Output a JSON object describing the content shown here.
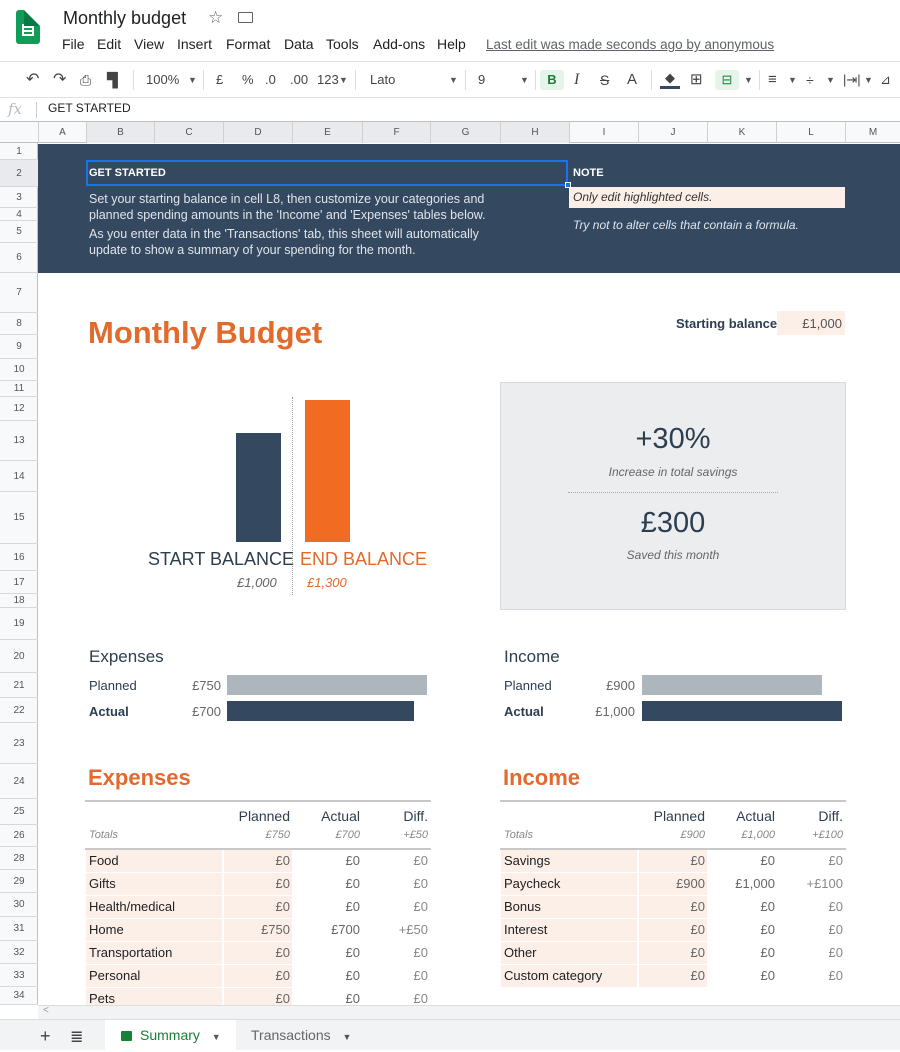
{
  "app": {
    "title": "Monthly budget",
    "menus": [
      "File",
      "Edit",
      "View",
      "Insert",
      "Format",
      "Data",
      "Tools",
      "Add-ons",
      "Help"
    ],
    "last_edit": "Last edit was made seconds ago by anonymous",
    "star_icon": "☆"
  },
  "toolbar": {
    "zoom": "100%",
    "currency": "£",
    "percent": "%",
    "dec_decrease": ".0",
    "dec_increase": ".00",
    "more_formats": "123",
    "font": "Lato",
    "font_size": "9",
    "bold": "B",
    "italic": "I",
    "strike": "S",
    "text_color": "A"
  },
  "formula_bar": {
    "fx": "fx",
    "value": "GET STARTED"
  },
  "columns": [
    "A",
    "B",
    "C",
    "D",
    "E",
    "F",
    "G",
    "H",
    "I",
    "J",
    "K",
    "L",
    "M"
  ],
  "rows": [
    "1",
    "2",
    "3",
    "4",
    "5",
    "6",
    "7",
    "8",
    "9",
    "10",
    "11",
    "12",
    "13",
    "14",
    "15",
    "16",
    "17",
    "18",
    "19",
    "20",
    "21",
    "22",
    "23",
    "24",
    "25",
    "26",
    "28",
    "29",
    "30",
    "31",
    "32",
    "33",
    "34"
  ],
  "banner": {
    "get_started": "GET STARTED",
    "line1": "Set your starting balance in cell L8, then customize your categories and",
    "line2": "planned spending amounts in the 'Income' and 'Expenses' tables below.",
    "line3": "As you enter data in the 'Transactions' tab, this sheet will automatically",
    "line4": "update to show a summary of your spending for the month.",
    "note": "NOTE",
    "note_highlight": "Only edit highlighted cells.",
    "note_2": "Try not to alter cells that contain a formula."
  },
  "main": {
    "title": "Monthly Budget",
    "starting_balance_label": "Starting balance:",
    "starting_balance_value": "£1,000"
  },
  "balance_chart": {
    "start_label": "START BALANCE",
    "end_label": "END BALANCE",
    "start_value_text": "£1,000",
    "end_value_text": "£1,300",
    "start_value": 1000,
    "end_value": 1300
  },
  "kpi": {
    "pct": "+30%",
    "pct_label": "Increase in total savings",
    "amount": "£300",
    "amount_label": "Saved this month"
  },
  "summary": {
    "expenses": {
      "title": "Expenses",
      "planned_label": "Planned",
      "actual_label": "Actual",
      "planned_text": "£750",
      "actual_text": "£700",
      "planned": 750,
      "actual": 700
    },
    "income": {
      "title": "Income",
      "planned_label": "Planned",
      "actual_label": "Actual",
      "planned_text": "£900",
      "actual_text": "£1,000",
      "planned": 900,
      "actual": 1000
    }
  },
  "expenses_table": {
    "title": "Expenses",
    "headers": [
      "Planned",
      "Actual",
      "Diff."
    ],
    "totals_label": "Totals",
    "totals": [
      "£750",
      "£700",
      "+£50"
    ],
    "rows": [
      {
        "cat": "Food",
        "planned": "£0",
        "actual": "£0",
        "diff": "£0"
      },
      {
        "cat": "Gifts",
        "planned": "£0",
        "actual": "£0",
        "diff": "£0"
      },
      {
        "cat": "Health/medical",
        "planned": "£0",
        "actual": "£0",
        "diff": "£0"
      },
      {
        "cat": "Home",
        "planned": "£750",
        "actual": "£700",
        "diff": "+£50"
      },
      {
        "cat": "Transportation",
        "planned": "£0",
        "actual": "£0",
        "diff": "£0"
      },
      {
        "cat": "Personal",
        "planned": "£0",
        "actual": "£0",
        "diff": "£0"
      },
      {
        "cat": "Pets",
        "planned": "£0",
        "actual": "£0",
        "diff": "£0"
      }
    ]
  },
  "income_table": {
    "title": "Income",
    "headers": [
      "Planned",
      "Actual",
      "Diff."
    ],
    "totals_label": "Totals",
    "totals": [
      "£900",
      "£1,000",
      "+£100"
    ],
    "rows": [
      {
        "cat": "Savings",
        "planned": "£0",
        "actual": "£0",
        "diff": "£0"
      },
      {
        "cat": "Paycheck",
        "planned": "£900",
        "actual": "£1,000",
        "diff": "+£100"
      },
      {
        "cat": "Bonus",
        "planned": "£0",
        "actual": "£0",
        "diff": "£0"
      },
      {
        "cat": "Interest",
        "planned": "£0",
        "actual": "£0",
        "diff": "£0"
      },
      {
        "cat": "Other",
        "planned": "£0",
        "actual": "£0",
        "diff": "£0"
      },
      {
        "cat": "Custom category",
        "planned": "£0",
        "actual": "£0",
        "diff": "£0"
      }
    ]
  },
  "sheet_tabs": [
    {
      "label": "Summary",
      "active": true
    },
    {
      "label": "Transactions",
      "active": false
    }
  ],
  "colors": {
    "navy": "#344960",
    "orange": "#f26b22",
    "title_orange": "#e26a2c",
    "highlight": "#fcefe8",
    "planned_bar": "#adb5bd"
  }
}
